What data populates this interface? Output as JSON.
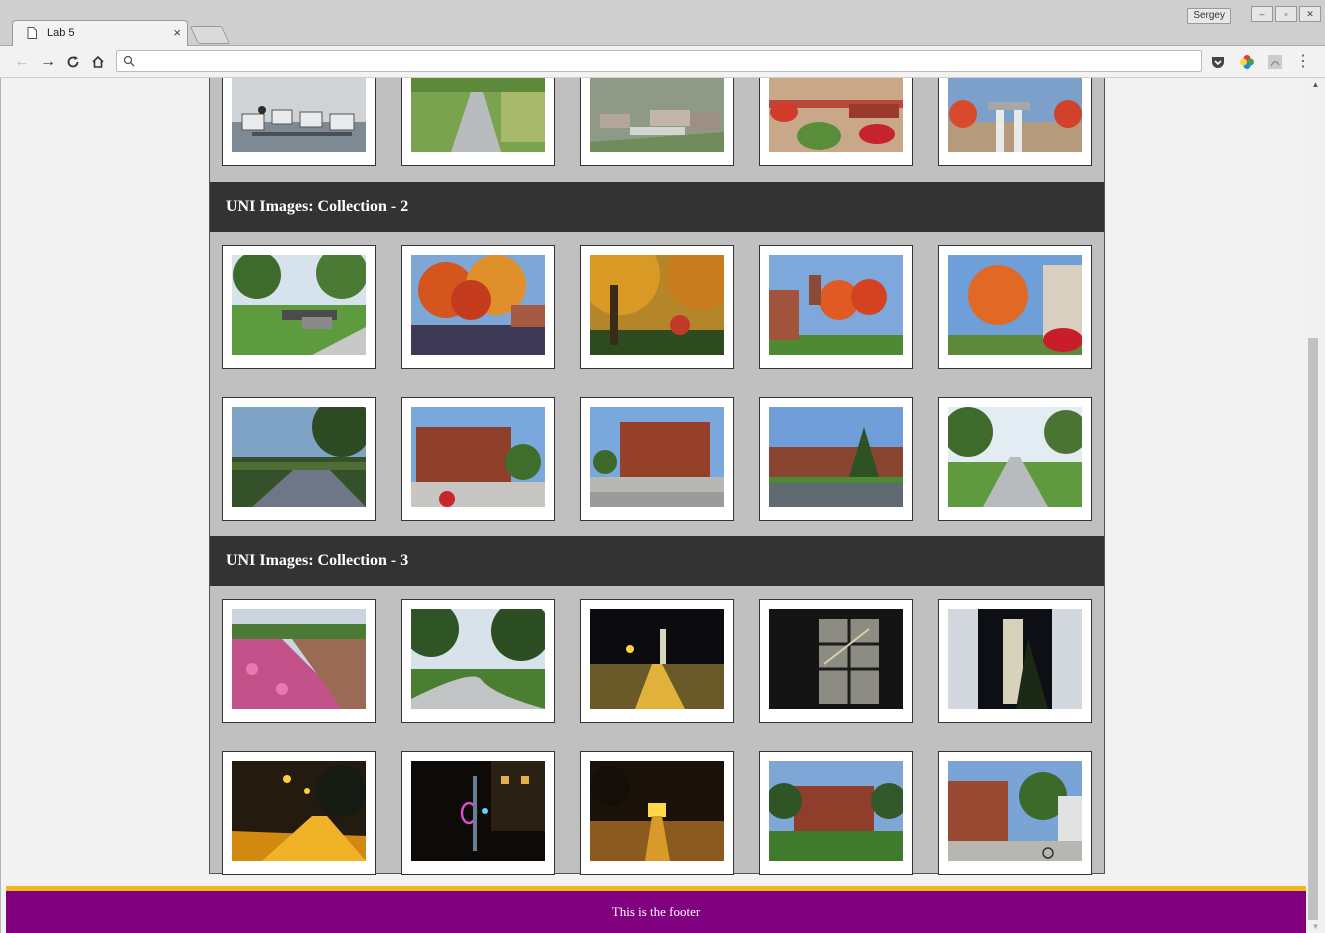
{
  "browser": {
    "tab_title": "Lab 5",
    "tab_close": "×",
    "profile_name": "Sergey",
    "address": "",
    "window_min": "‒",
    "window_max": "▫",
    "window_close": "✕",
    "menu": "⋮"
  },
  "page": {
    "section_2_title": "UNI Images: Collection - 2",
    "section_3_title": "UNI Images: Collection - 3",
    "footer": "This is the footer"
  },
  "gallery": {
    "collection_1_partial": [
      "computer-lab",
      "campus-sidewalk",
      "campus-aerial",
      "flowerbed-shrubs",
      "campus-clock"
    ],
    "collection_2": [
      "cannon-lawn",
      "autumn-trees",
      "autumn-canopy",
      "red-maple-building",
      "red-maple-path",
      "shaded-path",
      "brick-hall",
      "brick-hall-fountain",
      "hall-with-pine",
      "tree-lined-walk"
    ],
    "collection_3": [
      "pink-flowerbed",
      "curving-sidewalk",
      "campanile-night-path",
      "glass-stairwell-night",
      "campanile-tower",
      "lamp-lit-path",
      "night-sculpture",
      "night-building",
      "red-brick-mansion",
      "brick-building-bikes"
    ]
  },
  "colors": {
    "section_header": "#333333",
    "footer_bg": "#800080",
    "footer_border": "#f0b81d",
    "gallery_bg": "#c0c0c0"
  }
}
